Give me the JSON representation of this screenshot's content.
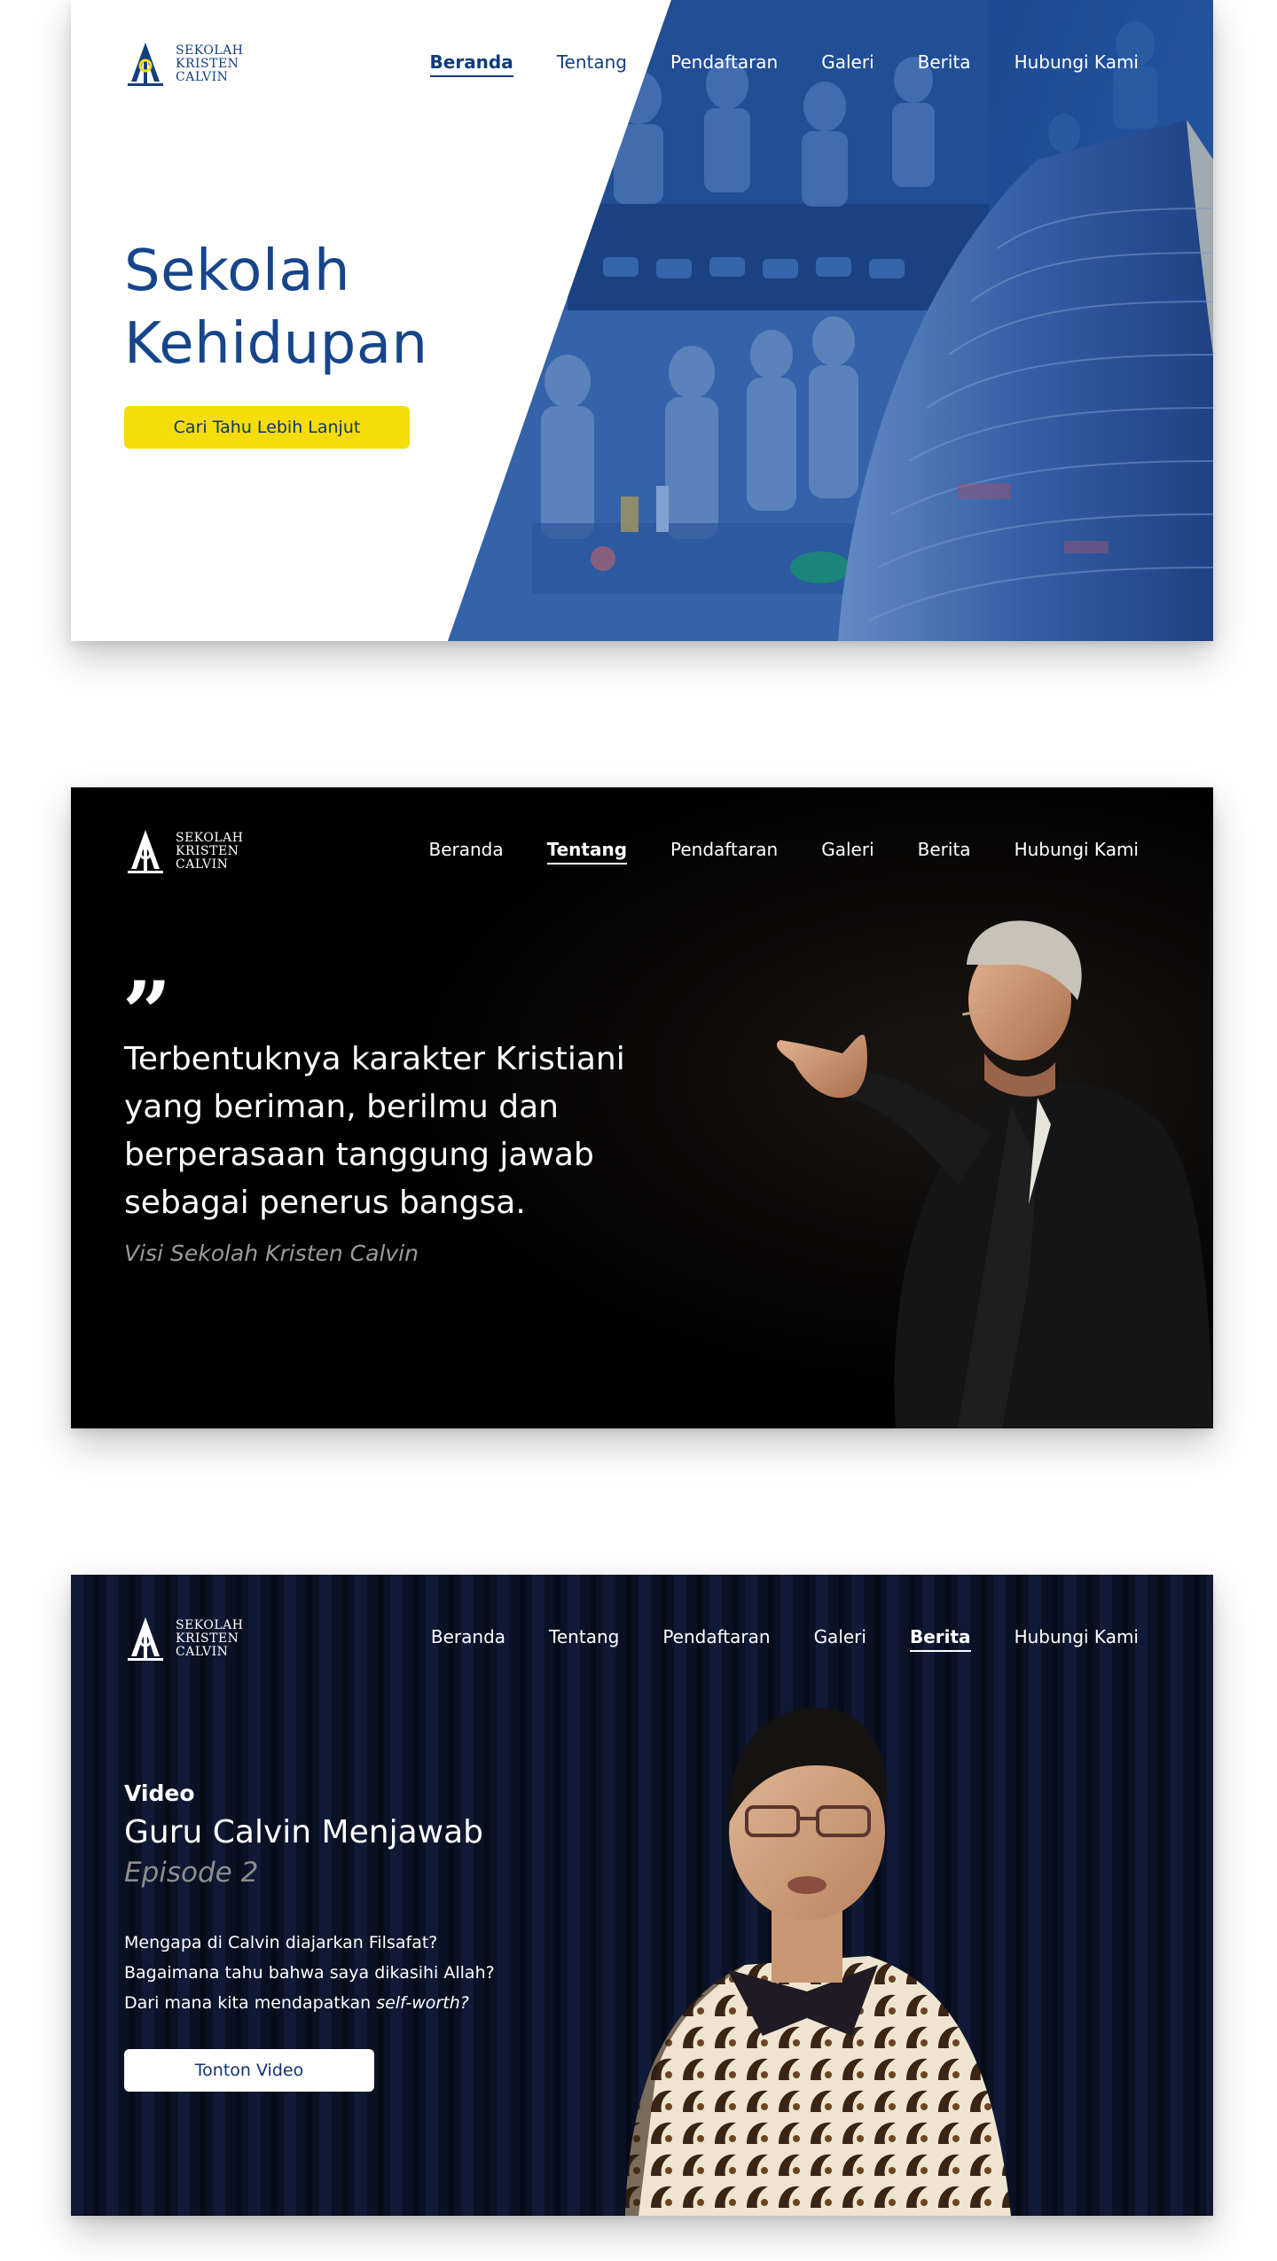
{
  "brand": {
    "name_lines": [
      "SEKOLAH",
      "KRISTEN",
      "CALVIN"
    ],
    "navy": "#143e7f",
    "yellow": "#f5dd0a"
  },
  "nav": [
    "Beranda",
    "Tentang",
    "Pendaftaran",
    "Galeri",
    "Berita",
    "Hubungi Kami"
  ],
  "slides": [
    {
      "active_nav": "Beranda",
      "title_lines": [
        "Sekolah",
        "Kehidupan"
      ],
      "cta_label": "Cari Tahu Lebih Lanjut"
    },
    {
      "active_nav": "Tentang",
      "quote_mark": "”",
      "quote_lines": [
        "Terbentuknya karakter Kristiani",
        "yang beriman, berilmu dan",
        "berperasaan tanggung jawab",
        "sebagai penerus bangsa."
      ],
      "caption": "Visi Sekolah Kristen Calvin"
    },
    {
      "active_nav": "Berita",
      "label": "Video",
      "title": "Guru Calvin Menjawab",
      "episode": "Episode 2",
      "description_lines": [
        "Mengapa di Calvin diajarkan Filsafat?",
        "Bagaimana tahu bahwa saya dikasihi Allah?"
      ],
      "description_last_prefix": "Dari mana kita mendapatkan ",
      "description_last_emphasis": "self-worth?",
      "cta_label": "Tonton Video"
    }
  ]
}
